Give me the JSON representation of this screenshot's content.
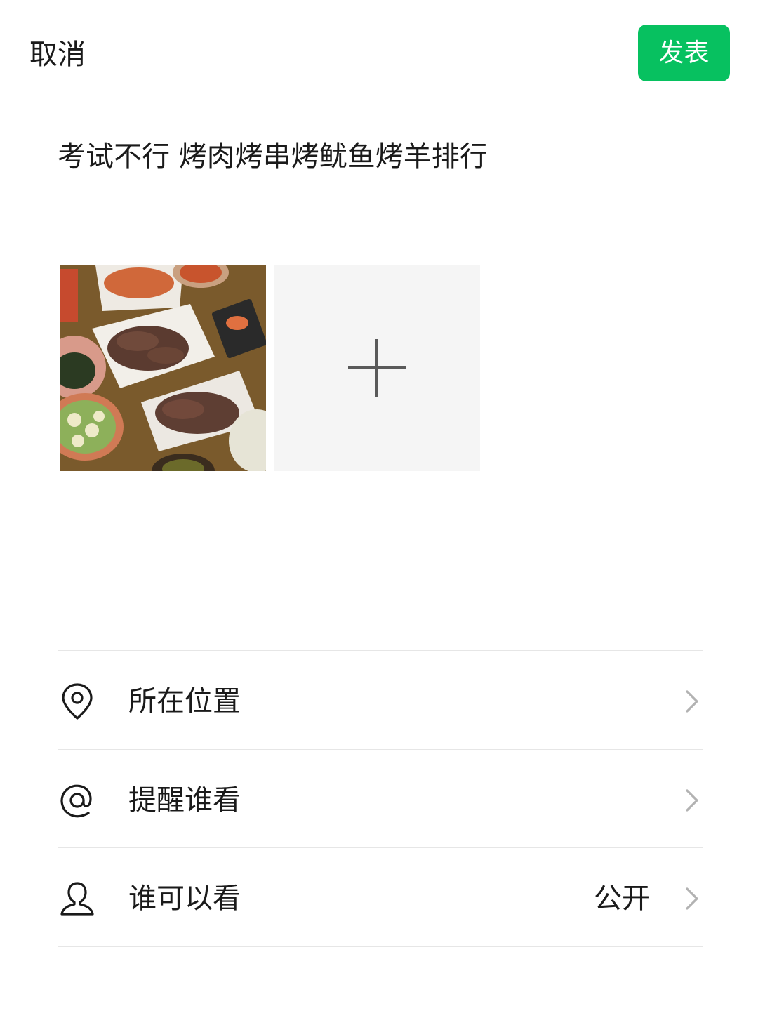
{
  "header": {
    "cancel_label": "取消",
    "publish_label": "发表"
  },
  "post": {
    "text": "考试不行 烤肉烤串烤鱿鱼烤羊排行"
  },
  "media": {
    "items": [
      {
        "type": "photo",
        "subject": "grilled meat and side dishes on a wooden table"
      }
    ],
    "add_icon": "plus-icon"
  },
  "options": [
    {
      "icon": "location-pin-icon",
      "label": "所在位置",
      "value": ""
    },
    {
      "icon": "at-icon",
      "label": "提醒谁看",
      "value": ""
    },
    {
      "icon": "person-icon",
      "label": "谁可以看",
      "value": "公开"
    }
  ],
  "colors": {
    "accent": "#07c160",
    "text": "#1a1a1a",
    "divider": "#e6e6e6",
    "chevron": "#b2b2b2",
    "add_tile_bg": "#f5f5f5"
  }
}
